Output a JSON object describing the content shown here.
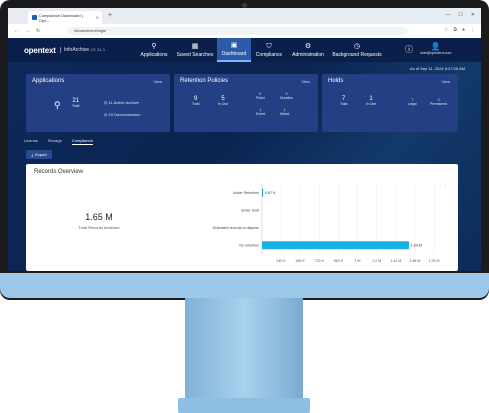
{
  "browser": {
    "tab_title": "Compliance Dashboard | Ope...",
    "url": "infoarchive/#/login"
  },
  "header": {
    "brand": "opentext",
    "product": "InfoArchive",
    "version": "CE 24.3",
    "nav": [
      {
        "label": "Applications",
        "icon": "applications-icon"
      },
      {
        "label": "Saved Searches",
        "icon": "saved-searches-icon"
      },
      {
        "label": "Dashboard",
        "icon": "dashboard-icon"
      },
      {
        "label": "Compliance",
        "icon": "compliance-shield-icon"
      },
      {
        "label": "Administration",
        "icon": "gear-icon"
      },
      {
        "label": "Background Requests",
        "icon": "clock-icon"
      }
    ],
    "active_nav": "Dashboard",
    "help_icon": "?",
    "user_email": "user@opentext.com"
  },
  "as_of": "As of Sep 11, 2024 9:27:06 AM",
  "cards": {
    "applications": {
      "title": "Applications",
      "view": "View",
      "total_value": "21",
      "total_label": "Total",
      "active_value": "11",
      "active_label": "Active Archive",
      "decommission_value": "10",
      "decommission_label": "Decommission"
    },
    "retention": {
      "title": "Retention Policies",
      "view": "View",
      "total_value": "9",
      "total_label": "Total",
      "inuse_value": "5",
      "inuse_label": "In Use",
      "fixed_value": "0",
      "fixed_label": "Fixed",
      "duration_value": "2",
      "duration_label": "Duration",
      "event_value": "1",
      "event_label": "Event",
      "mixed_value": "1",
      "mixed_label": "Mixed"
    },
    "holds": {
      "title": "Holds",
      "view": "View",
      "total_value": "7",
      "total_label": "Total",
      "inuse_value": "1",
      "inuse_label": "In Use",
      "legal_value": "7",
      "legal_label": "Legal",
      "permanent_value": "0",
      "permanent_label": "Permanent"
    }
  },
  "subtabs": [
    "License",
    "Storage",
    "Compliance"
  ],
  "active_subtab": "Compliance",
  "export_label": "Export",
  "records_overview": {
    "title": "Records Overview",
    "total_value": "1.65 M",
    "total_label": "Total Records Archived"
  },
  "chart_data": {
    "type": "bar",
    "orientation": "horizontal",
    "categories": [
      "Under Retention",
      "Under Hold",
      "Estimated records to dispose",
      "No retention"
    ],
    "values": [
      5670,
      0,
      0,
      1640000
    ],
    "data_labels": [
      "5.67 K",
      "",
      "",
      "1.64 M"
    ],
    "x_ticks": [
      "240 K",
      "480 K",
      "720 K",
      "960 K",
      "1 M",
      "1.2 M",
      "1.44 M",
      "1.68 M",
      "1.92 M"
    ],
    "xlim": [
      0,
      1920000
    ],
    "bar_color": "#1ab0e3",
    "grid": true
  },
  "colors": {
    "nav_bg": "#0a1f4a",
    "card_bg": "#243f83",
    "accent": "#1ab0e3"
  }
}
